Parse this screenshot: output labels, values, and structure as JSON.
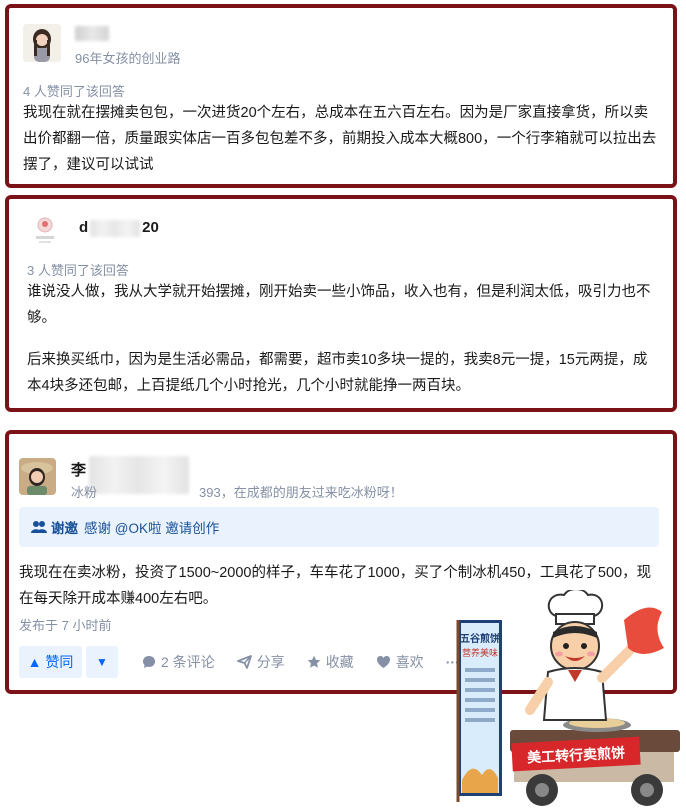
{
  "answers": [
    {
      "author_name": "黄**",
      "author_bio": "96年女孩的创业路",
      "votes": "4 人赞同了该回答",
      "paragraphs": [
        "我现在就在摆摊卖包包，一次进货20个左右，总成本在五六百左右。因为是厂家直接拿货，所以卖出价都翻一倍，质量跟实体店一百多包包差不多，前期投入成本大概800，一个行李箱就可以拉出去摆了，建议可以试试"
      ]
    },
    {
      "author_name_start": "d",
      "author_name_end": "20",
      "votes": "3 人赞同了该回答",
      "paragraphs": [
        "谁说没人做，我从大学就开始摆摊，刚开始卖一些小饰品，收入也有，但是利润太低，吸引力也不够。",
        "后来换买纸巾，因为是生活必需品，都需要，超市卖10多块一提的，我卖8元一提，15元两提，成本4块多还包邮，上百提纸几个小时抢光，几个小时就能挣一两百块。"
      ]
    },
    {
      "author_name_start": "李",
      "author_bio_start": "冰粉",
      "author_bio_end": "393，在成都的朋友过来吃冰粉呀！",
      "invite": {
        "strong": "谢邀",
        "text": "感谢 @OK啦 邀请创作"
      },
      "paragraphs": [
        "我现在在卖冰粉，投资了1500~2000的样子，车车花了1000，买了个制冰机450，工具花了500，现在每天除开成本赚400左右吧。"
      ],
      "published": "发布于 7 小时前",
      "actions": {
        "upvote": "▲ 赞同",
        "downvote": "▼",
        "comments": "2 条评论",
        "share": "分享",
        "favorite": "收藏",
        "like": "喜欢",
        "more": "···"
      }
    }
  ],
  "illustration": {
    "banner": "美工转行卖煎饼",
    "sign_title": "五谷煎饼",
    "sign_subtitle": "营养美味"
  },
  "colors": {
    "card_border": "#7a1217",
    "link_blue": "#0066ff",
    "meta_gray": "#8590a6",
    "invite_bg": "#eaf2fe"
  }
}
